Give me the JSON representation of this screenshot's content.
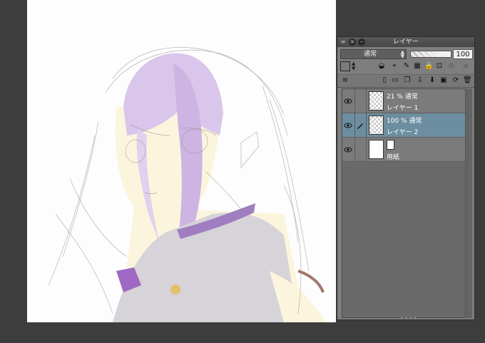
{
  "panel": {
    "title": "レイヤー",
    "blend_mode": "通常",
    "opacity": "100"
  },
  "layers": [
    {
      "mode": "21 % 通常",
      "name": "レイヤー 1"
    },
    {
      "mode": "100 % 通常",
      "name": "レイヤー 2"
    },
    {
      "mode": "",
      "name": "用紙"
    }
  ],
  "colors": {
    "selected_layer": "#6d8ea0",
    "hair_purple": "#b491d0",
    "skin": "#fbf2d6",
    "panel_bg": "#7e7e7e"
  }
}
